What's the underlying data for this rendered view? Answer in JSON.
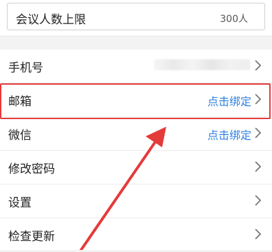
{
  "meeting_limit": {
    "label": "会议人数上限",
    "value": "300人"
  },
  "settings": {
    "items": [
      {
        "label": "手机号",
        "action": ""
      },
      {
        "label": "邮箱",
        "action": "点击绑定"
      },
      {
        "label": "微信",
        "action": "点击绑定"
      },
      {
        "label": "修改密码",
        "action": ""
      },
      {
        "label": "设置",
        "action": ""
      },
      {
        "label": "检查更新",
        "action": ""
      }
    ]
  },
  "colors": {
    "link": "#2f7fe0",
    "highlight": "#e53a3a",
    "arrow": "#e53a3a"
  },
  "icons": {
    "chevron": "chevron-right-icon"
  }
}
